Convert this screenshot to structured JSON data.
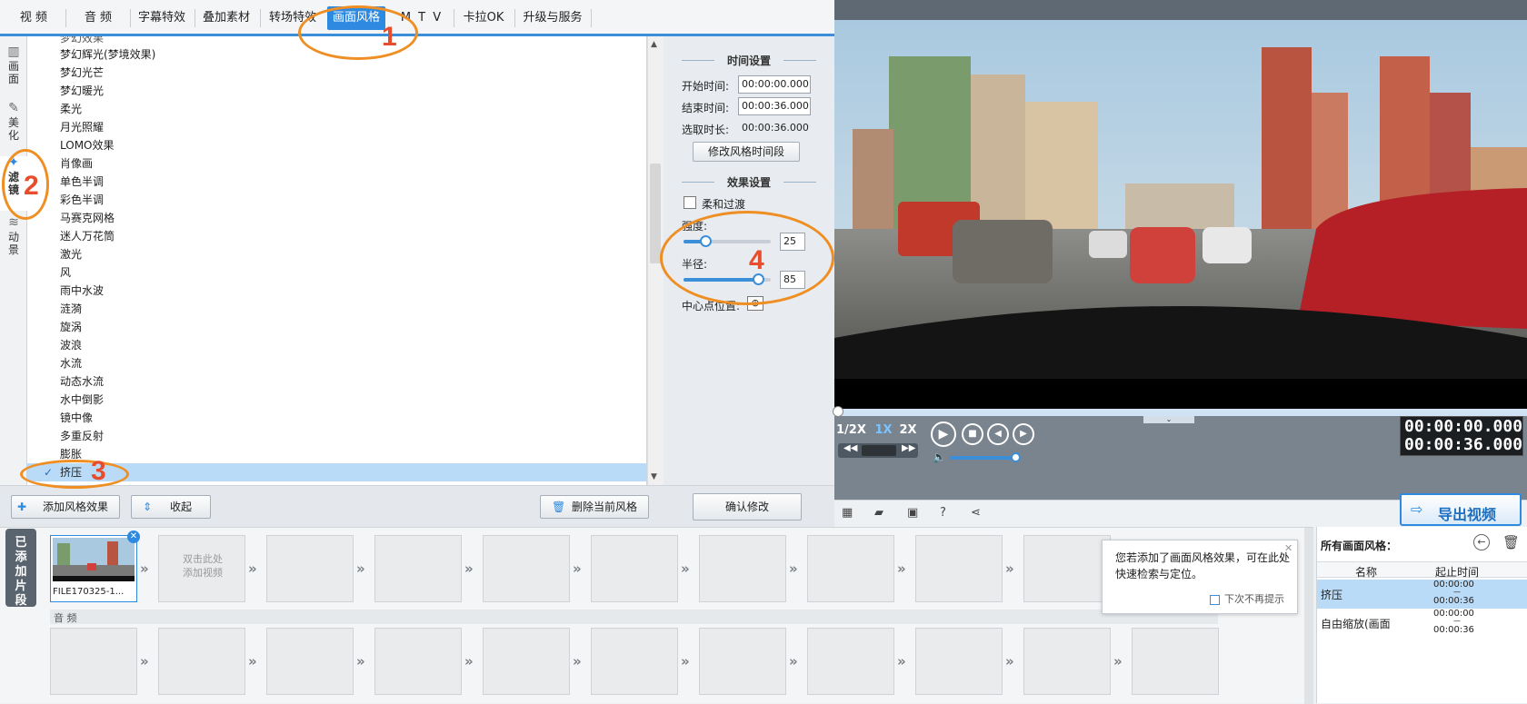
{
  "tabs": [
    "视 频",
    "音 频",
    "字幕特效",
    "叠加素材",
    "转场特效",
    "画面风格",
    "M T V",
    "卡拉OK",
    "升级与服务"
  ],
  "active_tab": "画面风格",
  "left_categories": [
    "画\n面",
    "美\n化",
    "滤\n镜",
    "动\n景"
  ],
  "filter_list": {
    "partial_top": "梦幻效果",
    "items": [
      "梦幻辉光(梦境效果)",
      "梦幻光芒",
      "梦幻暖光",
      "柔光",
      "月光照耀",
      "LOMO效果",
      "肖像画",
      "单色半调",
      "彩色半调",
      "马赛克网格",
      "迷人万花筒",
      "激光",
      "风",
      "雨中水波",
      "涟漪",
      "旋涡",
      "波浪",
      "水流",
      "动态水流",
      "水中倒影",
      "镜中像",
      "多重反射",
      "膨胀",
      "挤压"
    ],
    "selected": "挤压",
    "check": "✓"
  },
  "time_settings": {
    "title": "时间设置",
    "start_label": "开始时间:",
    "start_value": "00:00:00.000",
    "end_label": "结束时间:",
    "end_value": "00:00:36.000",
    "duration_label": "选取时长:",
    "duration_value": "00:00:36.000",
    "modify_button": "修改风格时间段"
  },
  "effect_settings": {
    "title": "效果设置",
    "smooth_label": "柔和过渡",
    "strength_label": "强度:",
    "strength_value": "25",
    "strength_level": 0.25,
    "radius_label": "半径:",
    "radius_value": "85",
    "radius_level": 0.85,
    "center_label": "中心点位置:",
    "confirm_button": "确认修改"
  },
  "left_toolbar": {
    "add_button": "添加风格效果",
    "collapse_button": "收起",
    "delete_button": "删除当前风格"
  },
  "player": {
    "speeds": [
      "1/2X",
      "1X",
      "2X"
    ],
    "current_time": "00:00:00.000",
    "total_time": "00:00:36.000",
    "export_button": "导出视频"
  },
  "timeline": {
    "label": "已添加片段",
    "clip_name": "FILE170325-1...",
    "empty_hint": "双击此处\n添加视频",
    "audio_label": "音 频"
  },
  "tooltip": {
    "text": "您若添加了画面风格效果，可在此处快速检索与定位。",
    "dont_show": "下次不再提示"
  },
  "right_panel": {
    "title": "所有画面风格：",
    "col_name": "名称",
    "col_time": "起止时间",
    "rows": [
      {
        "name": "挤压",
        "start": "00:00:00",
        "sep": "—",
        "end": "00:00:36"
      },
      {
        "name": "自由缩放(画面",
        "start": "00:00:00",
        "sep": "—",
        "end": "00:00:36"
      }
    ]
  },
  "annotations": [
    "1",
    "2",
    "3",
    "4"
  ],
  "colors": {
    "accent": "#2d8ae0",
    "annotation_ring": "#ef8e22",
    "annotation_number": "#e74d2c",
    "selection": "#b9dbf7"
  }
}
